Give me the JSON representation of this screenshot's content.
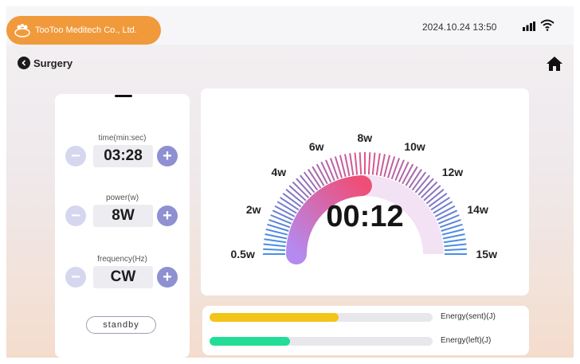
{
  "header": {
    "brand": "TooToo Meditech Co., Ltd.",
    "datetime": "2024.10.24  13:50",
    "icons": [
      "signal-icon",
      "wifi-icon"
    ]
  },
  "nav": {
    "back_label": "Surgery",
    "icons": [
      "back-icon",
      "home-icon"
    ]
  },
  "controls": [
    {
      "label": "time(min:sec)",
      "value": "03:28"
    },
    {
      "label": "power(w)",
      "value": "8W"
    },
    {
      "label": "frequency(Hz)",
      "value": "CW"
    }
  ],
  "standby_label": "standby",
  "gauge": {
    "labels": [
      "0.5w",
      "2w",
      "4w",
      "6w",
      "8w",
      "10w",
      "12w",
      "14w",
      "15w"
    ],
    "min": 0.5,
    "max": 15,
    "current": 8,
    "timer": "00:12",
    "colors": {
      "progress_start": "#b48af0",
      "progress_end": "#ee4f78",
      "ticks_cool": "#4a8de6",
      "ticks_warm": "#e0548c"
    }
  },
  "energy": [
    {
      "label": "Energy(sent)(J)",
      "fraction": 0.58,
      "color": "#f3c419"
    },
    {
      "label": "Energy(left)(J)",
      "fraction": 0.36,
      "color": "#22dd96"
    }
  ]
}
